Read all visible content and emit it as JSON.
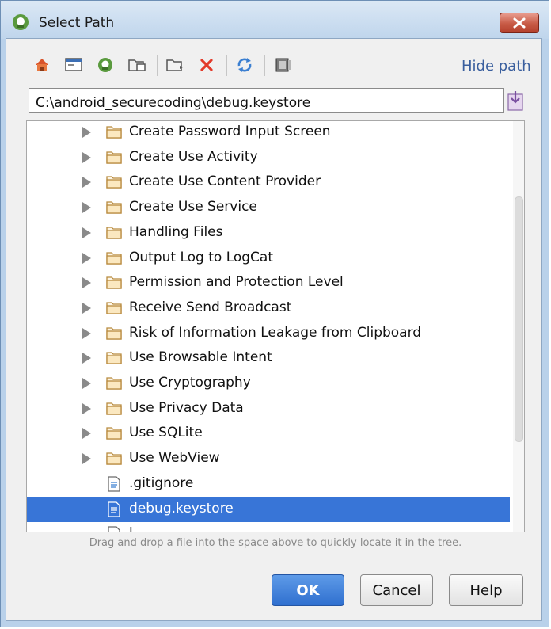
{
  "window": {
    "title": "Select Path"
  },
  "toolbar": {
    "buttons": [
      {
        "name": "home-icon"
      },
      {
        "name": "desktop-icon"
      },
      {
        "name": "project-icon"
      },
      {
        "name": "module-icon"
      },
      {
        "name": "new-folder-icon"
      },
      {
        "name": "delete-icon"
      },
      {
        "name": "refresh-icon"
      },
      {
        "name": "show-hidden-icon"
      }
    ],
    "hide_path_label": "Hide path"
  },
  "path": {
    "value": "C:\\android_securecoding\\debug.keystore"
  },
  "tree": {
    "items": [
      {
        "label": "Create Password Input Screen",
        "type": "folder"
      },
      {
        "label": "Create Use Activity",
        "type": "folder"
      },
      {
        "label": "Create Use Content Provider",
        "type": "folder"
      },
      {
        "label": "Create Use Service",
        "type": "folder"
      },
      {
        "label": "Handling Files",
        "type": "folder"
      },
      {
        "label": "Output Log to LogCat",
        "type": "folder"
      },
      {
        "label": "Permission and Protection Level",
        "type": "folder"
      },
      {
        "label": "Receive Send Broadcast",
        "type": "folder"
      },
      {
        "label": "Risk of Information Leakage from Clipboard",
        "type": "folder"
      },
      {
        "label": "Use Browsable Intent",
        "type": "folder"
      },
      {
        "label": "Use Cryptography",
        "type": "folder"
      },
      {
        "label": "Use Privacy Data",
        "type": "folder"
      },
      {
        "label": "Use SQLite",
        "type": "folder"
      },
      {
        "label": "Use WebView",
        "type": "folder"
      },
      {
        "label": ".gitignore",
        "type": "file"
      },
      {
        "label": "debug.keystore",
        "type": "file",
        "selected": true
      },
      {
        "label": "l",
        "type": "file"
      }
    ]
  },
  "hint": "Drag and drop a file into the space above to quickly locate it in the tree.",
  "buttons": {
    "ok": "OK",
    "cancel": "Cancel",
    "help": "Help"
  },
  "colors": {
    "selection": "#3875d7",
    "link": "#3a5f9e",
    "delete": "#e33a2a",
    "folder": "#f6c66a"
  }
}
